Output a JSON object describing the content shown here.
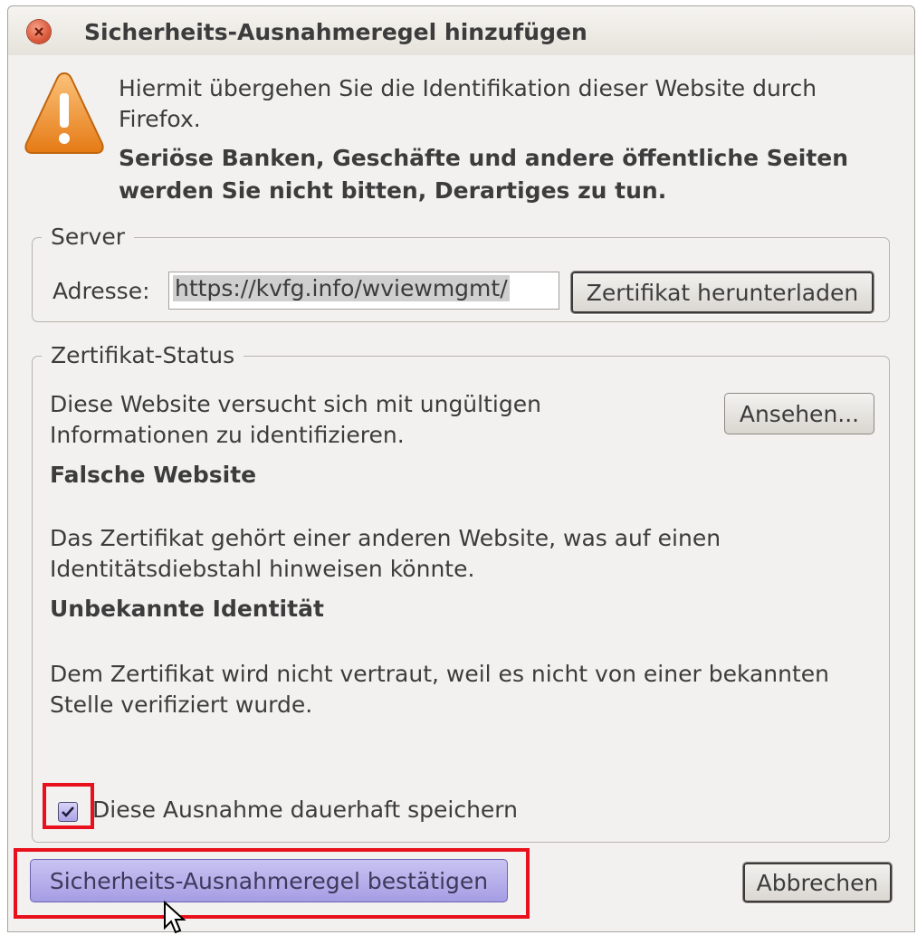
{
  "window": {
    "title": "Sicherheits-Ausnahmeregel hinzufügen"
  },
  "warning": {
    "line1": "Hiermit übergehen Sie die Identifikation dieser Website durch Firefox.",
    "line2": "Seriöse Banken, Geschäfte und andere öffentliche Seiten werden Sie nicht bitten, Derartiges zu tun."
  },
  "server": {
    "legend": "Server",
    "address_label": "Adresse:",
    "address_value": "https://kvfg.info/wviewmgmt/",
    "download_button": "Zertifikat herunterladen"
  },
  "status": {
    "legend": "Zertifikat-Status",
    "intro": "Diese Website versucht sich mit ungültigen Informationen zu identifizieren.",
    "view_button": "Ansehen...",
    "issue1_title": "Falsche Website",
    "issue1_text": "Das Zertifikat gehört einer anderen Website, was auf einen Identitätsdiebstahl hinweisen könnte.",
    "issue2_title": "Unbekannte Identität",
    "issue2_text": "Dem Zertifikat wird nicht vertraut, weil es nicht von einer bekannten Stelle verifiziert wurde.",
    "permanent_label": "Diese Ausnahme dauerhaft speichern",
    "permanent_checked": true
  },
  "buttons": {
    "confirm": "Sicherheits-Ausnahmeregel bestätigen",
    "cancel": "Abbrechen"
  },
  "colors": {
    "highlight": "#e8101c",
    "primary_button": "#a59de3"
  }
}
